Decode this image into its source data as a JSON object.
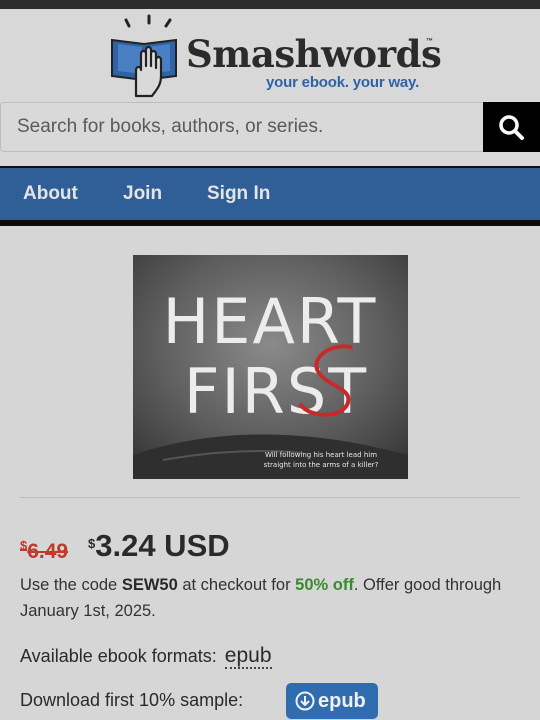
{
  "header": {
    "brand": "Smashwords",
    "trademark": "™",
    "tagline": "your ebook. your way."
  },
  "search": {
    "placeholder": "Search for books, authors, or series.",
    "button_icon": "search-icon"
  },
  "nav": {
    "items": [
      {
        "label": "About"
      },
      {
        "label": "Join"
      },
      {
        "label": "Sign In"
      }
    ]
  },
  "book": {
    "cover": {
      "title_line1": "HEART",
      "title_line2": "FIRST",
      "blurb_line1": "Will following his heart lead him",
      "blurb_line2": "straight into the arms of a killer?"
    },
    "price": {
      "currency_symbol": "$",
      "old_amount": "6.49",
      "new_amount": "3.24 USD"
    },
    "promo": {
      "text1": "Use the code ",
      "code": "SEW50",
      "text2": " at checkout for ",
      "discount": "50% off",
      "text3": ". Offer good through January 1st, 2025."
    },
    "formats": {
      "label": "Available ebook formats:",
      "value": "epub"
    },
    "sample": {
      "label": "Download first 10% sample:",
      "button_label": "epub",
      "button_icon": "download-circle-icon"
    }
  },
  "colors": {
    "nav_bg": "#2f5f96",
    "tagline": "#2f62a6",
    "old_price": "#c0392b",
    "discount": "#3b8a2e",
    "sample_button": "#2f6cb0"
  }
}
